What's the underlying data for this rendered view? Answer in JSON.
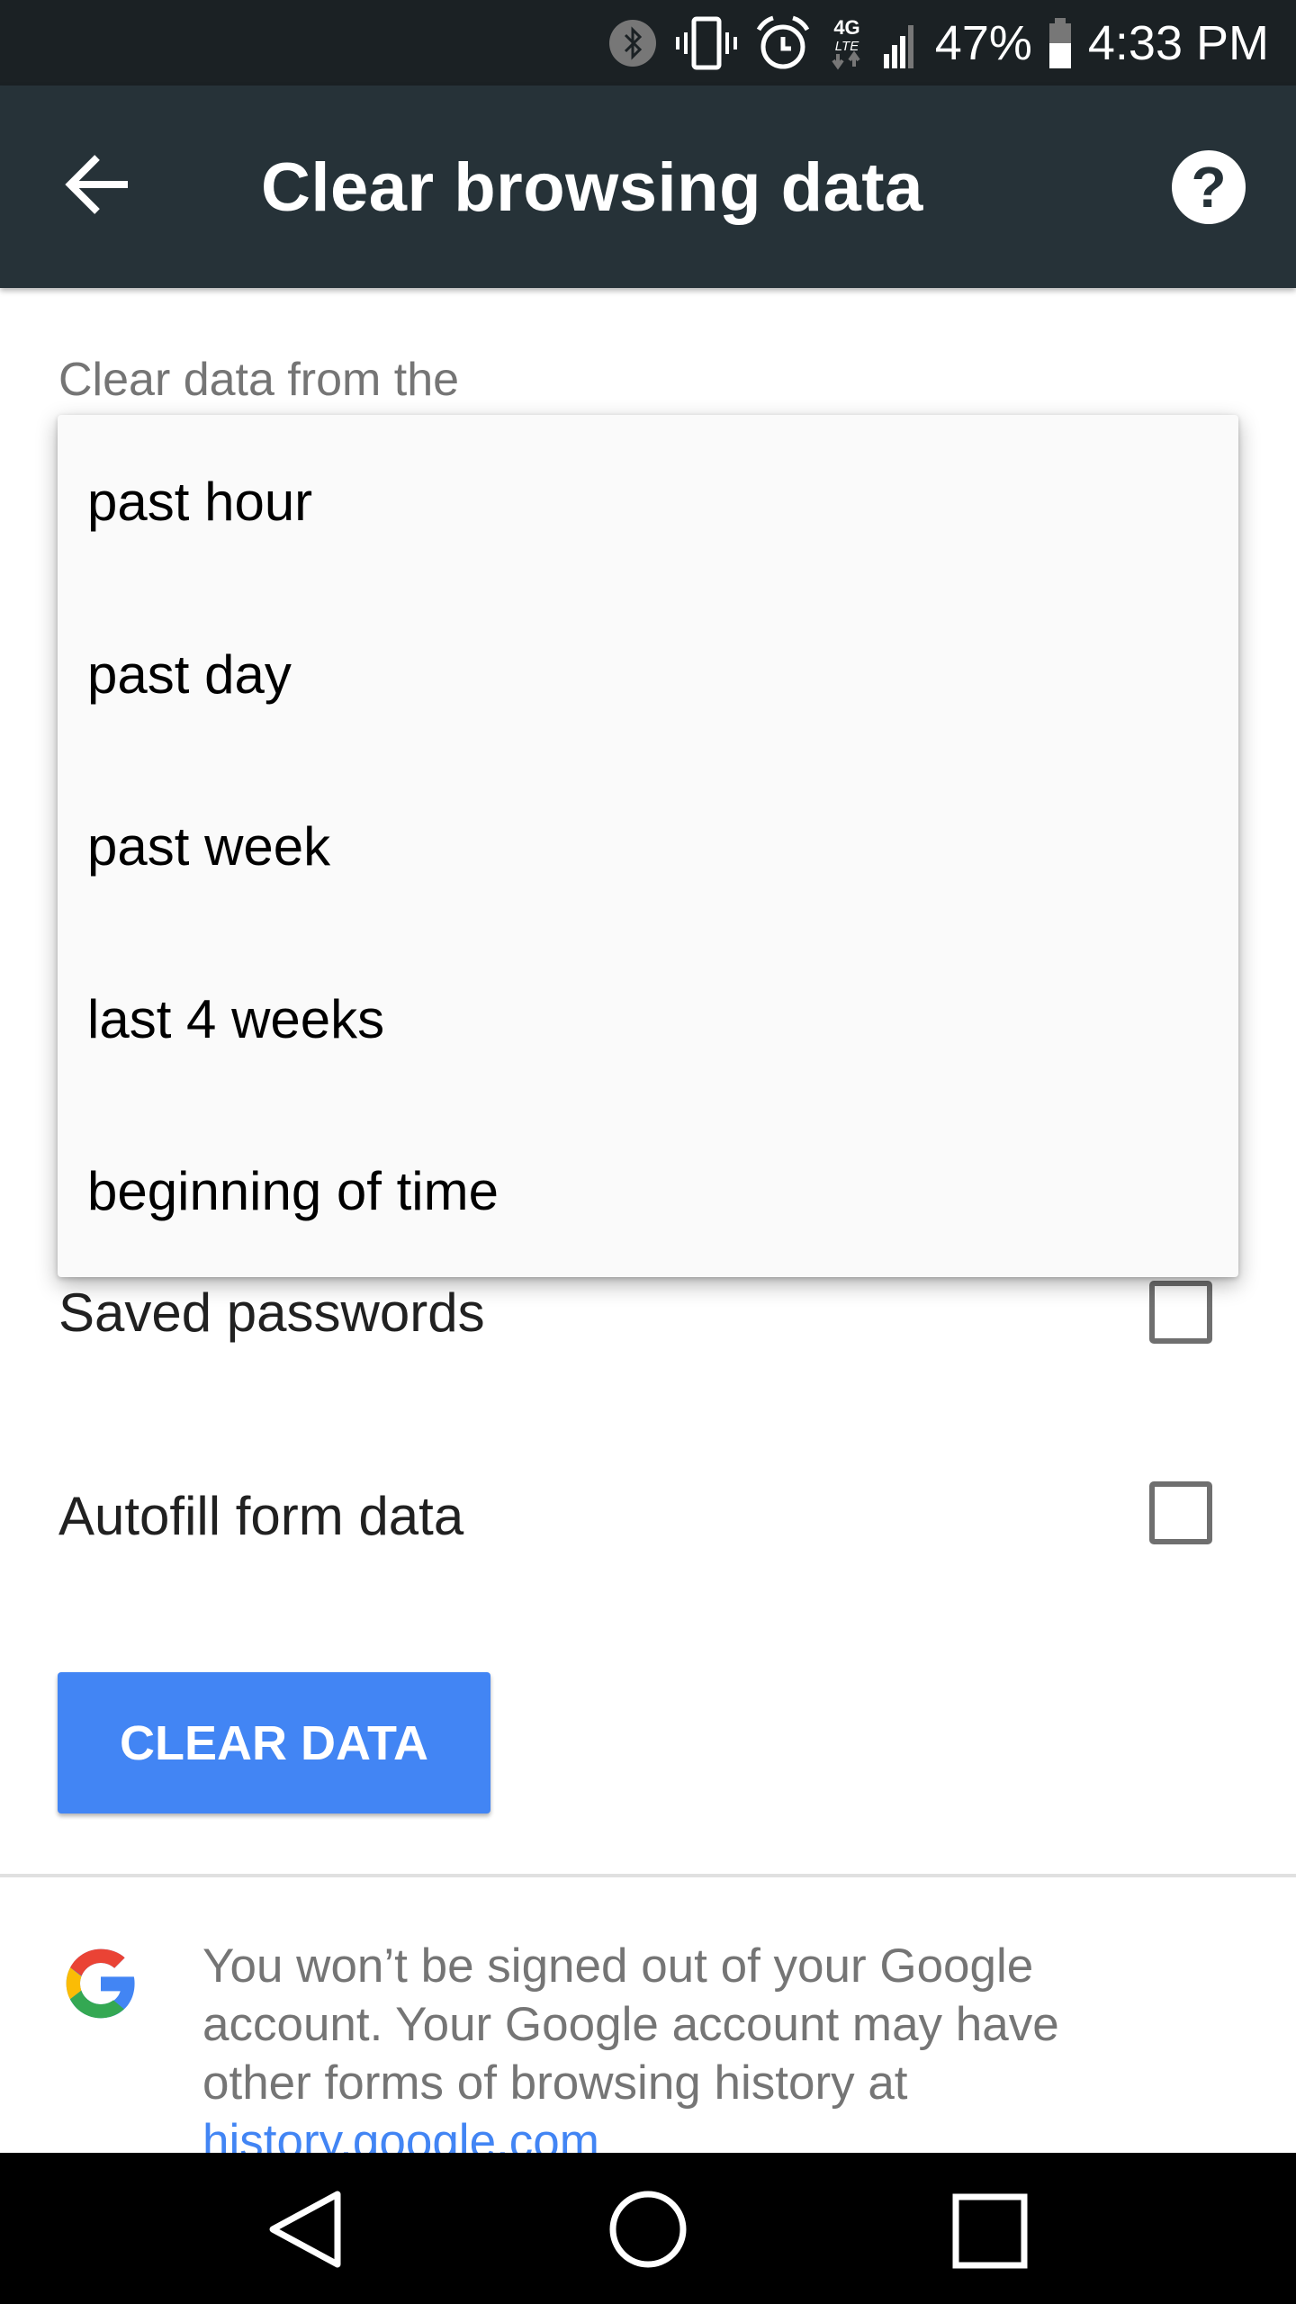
{
  "status_bar": {
    "battery": "47%",
    "time": "4:33 PM",
    "network": "4G LTE",
    "icons": [
      "bluetooth-icon",
      "vibrate-icon",
      "alarm-icon",
      "4g-lte-icon",
      "signal-icon",
      "battery-icon"
    ]
  },
  "app_bar": {
    "title": "Clear browsing data",
    "back_icon": "arrow-back-icon",
    "help_icon": "help-icon",
    "help_glyph": "?"
  },
  "time_range": {
    "label": "Clear data from the",
    "options": [
      "past hour",
      "past day",
      "past week",
      "last 4 weeks",
      "beginning of time"
    ]
  },
  "items": [
    {
      "label": "Saved passwords",
      "checked": false
    },
    {
      "label": "Autofill form data",
      "checked": false
    }
  ],
  "clear_button": "CLEAR DATA",
  "info": {
    "text": "You won’t be signed out of your Google account. Your Google account may have other forms of browsing history at ",
    "link": "history.google.com"
  },
  "colors": {
    "app_bar": "#263238",
    "accent": "#4285f4"
  }
}
